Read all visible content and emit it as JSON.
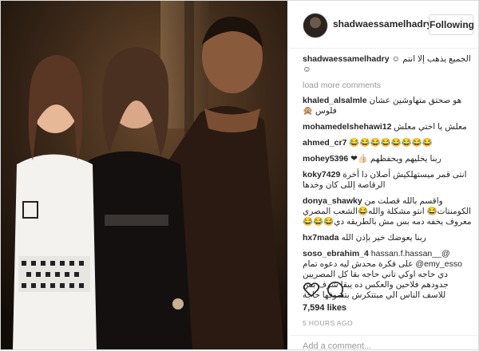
{
  "header": {
    "username": "shadwaessamelhadry",
    "follow_label": "Following"
  },
  "caption": {
    "user": "shadwaessamelhadry",
    "text": "الجميع يذهب إلا انتم ☺︎☺︎"
  },
  "load_more": "load more comments",
  "comments": [
    {
      "user": "khaled_alsalmle",
      "text": "هو صحتق متهاوشين عشان فلوس 🙊"
    },
    {
      "user": "mohamedelshehawi12",
      "text": "معلش يا اختي معلش"
    },
    {
      "user": "ahmed_cr7",
      "text": "😂😂😂😂😂😂😂😂"
    },
    {
      "user": "mohey5396",
      "text": "ربنا يخليهم ويحفظهم 👍🏻❤"
    },
    {
      "user": "koky7429",
      "text": "انتى قمر ميستهلكيش أصلان دا أخرة الرقاصة إللى كان وخدها"
    },
    {
      "user": "donya_shawky",
      "text": "واقسم بالله قصلت من الكومنتات😂 انتو مشكلة والله😂الشعب المصري معروف يخفه دمه بس مش بالطريقه دي😂😂😂"
    },
    {
      "user": "hx7mada",
      "text": "ربنا يعوضك خير بإذن الله"
    },
    {
      "user": "soso_ebrahim_4",
      "text": "@_hassan.f.hassan_ @emy_esso على فكرة محدش ليه دعوه تمام دي حاجه اوكي تاني حاجه بقا كل المصريين جدودهم فلاحين والعكس ده يبقا شرف بس للاسف الناس الي مبتتكرش بتشوفها حاجة"
    }
  ],
  "likes": "7,594 likes",
  "time": "5 HOURS AGO",
  "add_comment_placeholder": "Add a comment..."
}
